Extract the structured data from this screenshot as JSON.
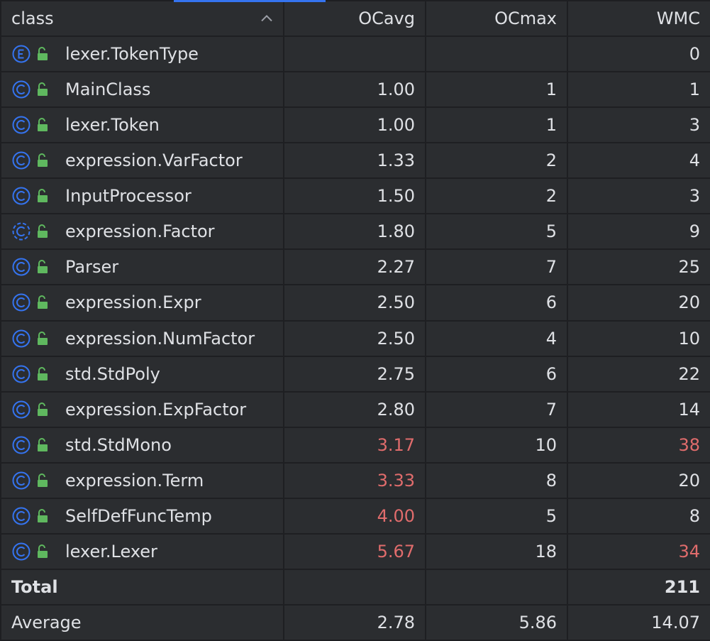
{
  "columns": {
    "class": "class",
    "ocavg": "OCavg",
    "ocmax": "OCmax",
    "wmc": "WMC"
  },
  "colors": {
    "background": "#2b2d30",
    "grid": "#1e1f22",
    "text": "#dfe1e5",
    "warning": "#e06c6c",
    "class_icon": "#3574f0",
    "lock_icon": "#5fb85f",
    "sort_accent": "#3574f0"
  },
  "sort": {
    "column": "class",
    "direction": "ascending",
    "icon": "chevron-up-icon"
  },
  "rows": [
    {
      "kind": "enum",
      "name": "lexer.TokenType",
      "ocavg": "",
      "ocmax": "",
      "wmc": "0",
      "warn": []
    },
    {
      "kind": "class",
      "name": "MainClass",
      "ocavg": "1.00",
      "ocmax": "1",
      "wmc": "1",
      "warn": []
    },
    {
      "kind": "class",
      "name": "lexer.Token",
      "ocavg": "1.00",
      "ocmax": "1",
      "wmc": "3",
      "warn": []
    },
    {
      "kind": "class",
      "name": "expression.VarFactor",
      "ocavg": "1.33",
      "ocmax": "2",
      "wmc": "4",
      "warn": []
    },
    {
      "kind": "class",
      "name": "InputProcessor",
      "ocavg": "1.50",
      "ocmax": "2",
      "wmc": "3",
      "warn": []
    },
    {
      "kind": "abstract-class",
      "name": "expression.Factor",
      "ocavg": "1.80",
      "ocmax": "5",
      "wmc": "9",
      "warn": []
    },
    {
      "kind": "class",
      "name": "Parser",
      "ocavg": "2.27",
      "ocmax": "7",
      "wmc": "25",
      "warn": []
    },
    {
      "kind": "class",
      "name": "expression.Expr",
      "ocavg": "2.50",
      "ocmax": "6",
      "wmc": "20",
      "warn": []
    },
    {
      "kind": "class",
      "name": "expression.NumFactor",
      "ocavg": "2.50",
      "ocmax": "4",
      "wmc": "10",
      "warn": []
    },
    {
      "kind": "class",
      "name": "std.StdPoly",
      "ocavg": "2.75",
      "ocmax": "6",
      "wmc": "22",
      "warn": []
    },
    {
      "kind": "class",
      "name": "expression.ExpFactor",
      "ocavg": "2.80",
      "ocmax": "7",
      "wmc": "14",
      "warn": []
    },
    {
      "kind": "class",
      "name": "std.StdMono",
      "ocavg": "3.17",
      "ocmax": "10",
      "wmc": "38",
      "warn": [
        "ocavg",
        "wmc"
      ]
    },
    {
      "kind": "class",
      "name": "expression.Term",
      "ocavg": "3.33",
      "ocmax": "8",
      "wmc": "20",
      "warn": [
        "ocavg"
      ]
    },
    {
      "kind": "class",
      "name": "SelfDefFuncTemp",
      "ocavg": "4.00",
      "ocmax": "5",
      "wmc": "8",
      "warn": [
        "ocavg"
      ]
    },
    {
      "kind": "class",
      "name": "lexer.Lexer",
      "ocavg": "5.67",
      "ocmax": "18",
      "wmc": "34",
      "warn": [
        "ocavg",
        "wmc"
      ]
    }
  ],
  "total": {
    "label": "Total",
    "ocavg": "",
    "ocmax": "",
    "wmc": "211"
  },
  "average": {
    "label": "Average",
    "ocavg": "2.78",
    "ocmax": "5.86",
    "wmc": "14.07"
  }
}
